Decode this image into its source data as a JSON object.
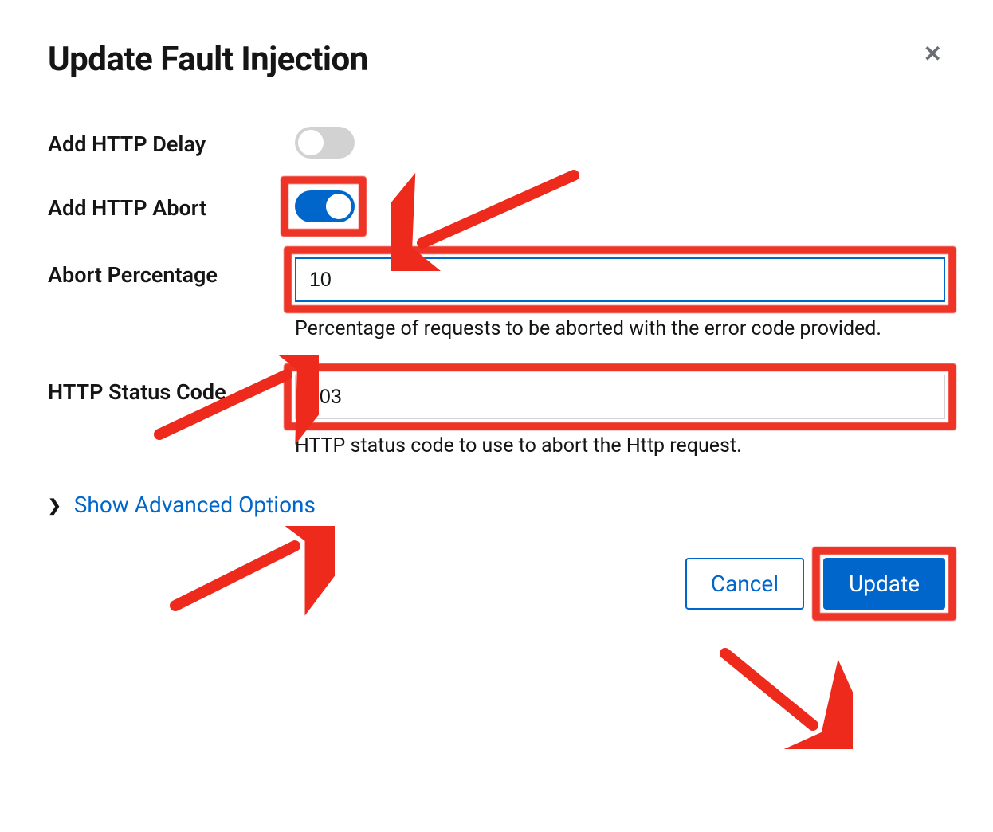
{
  "dialog": {
    "title": "Update Fault Injection",
    "close_label": "✕"
  },
  "fields": {
    "http_delay": {
      "label": "Add HTTP Delay",
      "value": false
    },
    "http_abort": {
      "label": "Add HTTP Abort",
      "value": true
    },
    "abort_percentage": {
      "label": "Abort Percentage",
      "value": "10",
      "help": "Percentage of requests to be aborted with the error code provided."
    },
    "http_status_code": {
      "label": "HTTP Status Code",
      "value": "503",
      "help": "HTTP status code to use to abort the Http request."
    }
  },
  "advanced": {
    "chevron": "❯",
    "label": "Show Advanced Options"
  },
  "buttons": {
    "cancel": "Cancel",
    "update": "Update"
  },
  "colors": {
    "primary": "#0066cc",
    "annotation": "#ed2a1c"
  }
}
